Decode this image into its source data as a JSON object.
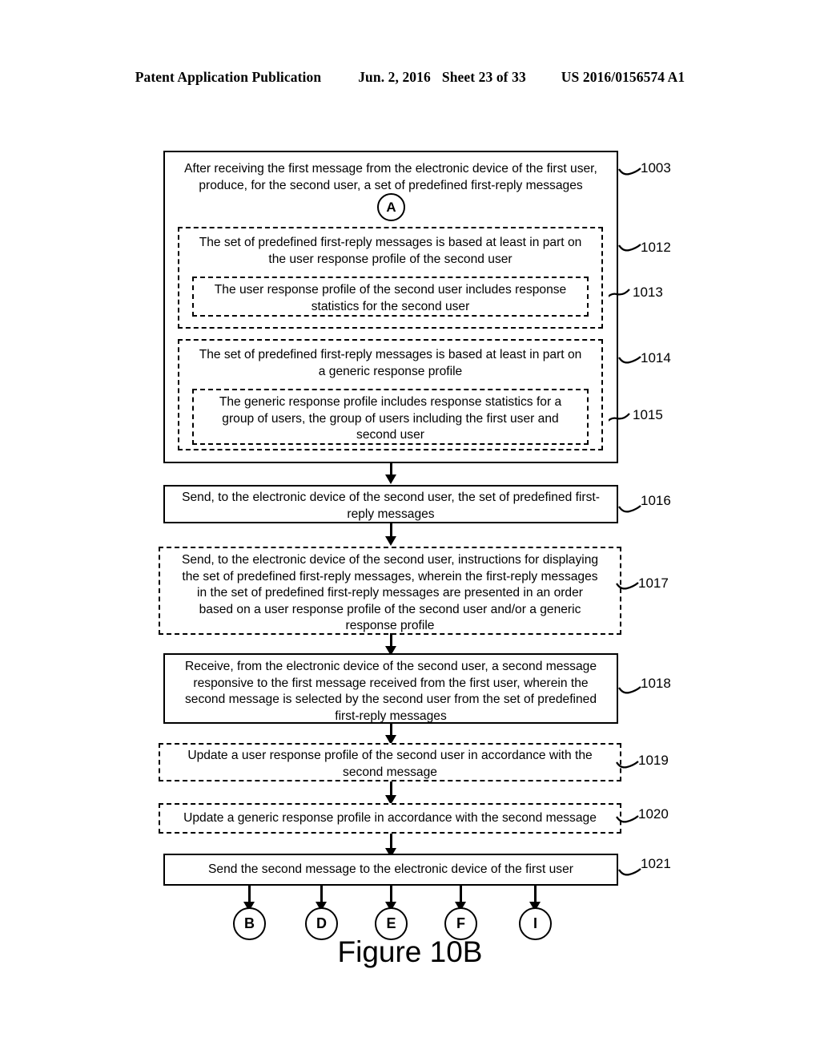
{
  "header": {
    "publication": "Patent Application Publication",
    "date": "Jun. 2, 2016",
    "sheet": "Sheet 23 of 33",
    "patent_number": "US 2016/0156574 A1"
  },
  "figure": {
    "caption": "Figure 10B",
    "entry_tag": "A",
    "exit_tags": [
      "B",
      "D",
      "E",
      "F",
      "I"
    ],
    "boxes": [
      {
        "ref": "1003",
        "style": "solid",
        "text": "After receiving the first message from the electronic device of the first user,\nproduce, for the second user, a set of predefined first-reply messages"
      },
      {
        "ref": "1012",
        "style": "dashed",
        "text": "The set of predefined first-reply messages is based at least in part on\nthe user response profile of the second user"
      },
      {
        "ref": "1013",
        "style": "dashed",
        "text": "The user response profile of the second user includes response\nstatistics for the second user"
      },
      {
        "ref": "1014",
        "style": "dashed",
        "text": "The set of predefined first-reply messages is based at least in part on\na generic response profile"
      },
      {
        "ref": "1015",
        "style": "dashed",
        "text": "The generic response profile includes response statistics for a\ngroup of users, the group of users including the first user and\nsecond user"
      },
      {
        "ref": "1016",
        "style": "solid",
        "text": "Send, to the electronic device of the second user, the set of predefined first-\nreply messages"
      },
      {
        "ref": "1017",
        "style": "dashed",
        "text": "Send, to the electronic device of the second user, instructions for displaying\nthe set of predefined first-reply messages, wherein the first-reply messages\nin the set of predefined first-reply messages are presented in an order\nbased on a user response profile of the second user and/or a generic\nresponse profile"
      },
      {
        "ref": "1018",
        "style": "solid",
        "text": "Receive, from the electronic device of the second user, a second message\nresponsive to the first message received from the first user, wherein the\nsecond message is selected by the second user from the set of predefined\nfirst-reply messages"
      },
      {
        "ref": "1019",
        "style": "dashed",
        "text": "Update a user response profile of the second user in accordance with the\nsecond message"
      },
      {
        "ref": "1020",
        "style": "dashed",
        "text": "Update a generic response profile in accordance with the second message"
      },
      {
        "ref": "1021",
        "style": "solid",
        "text": "Send the second message to the electronic device of the first user"
      }
    ]
  }
}
